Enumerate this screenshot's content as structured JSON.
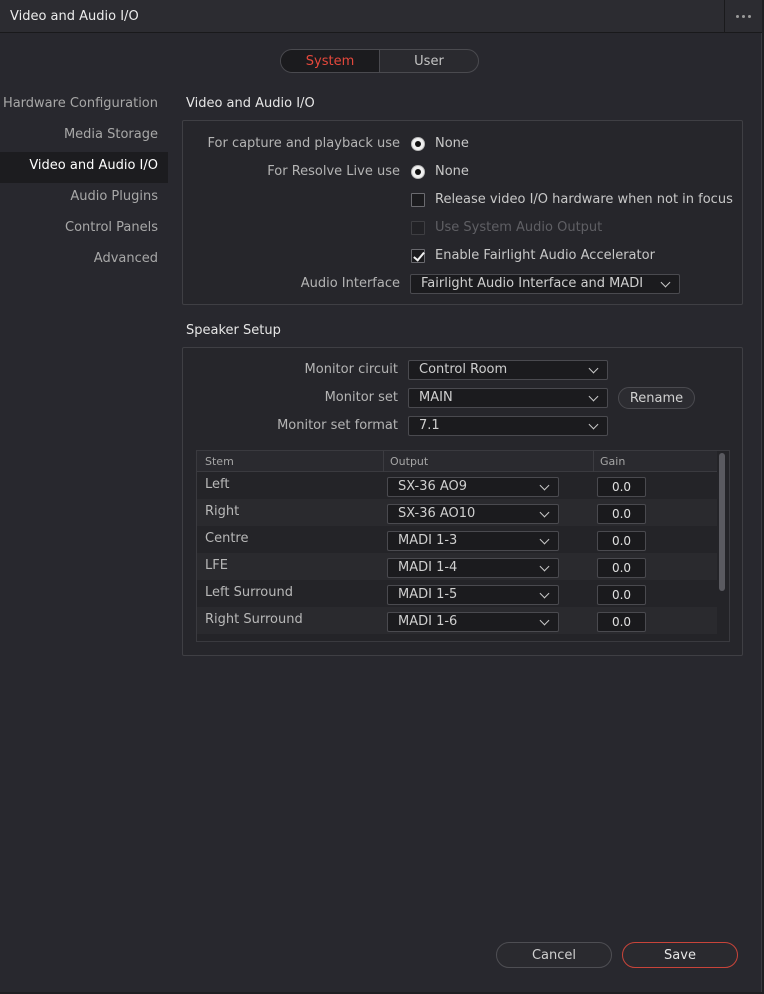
{
  "window": {
    "title": "Video and Audio I/O"
  },
  "tabs": [
    {
      "label": "System"
    },
    {
      "label": "User"
    }
  ],
  "sidebar": {
    "items": [
      {
        "label": "Hardware Configuration"
      },
      {
        "label": "Media Storage"
      },
      {
        "label": "Video and Audio I/O"
      },
      {
        "label": "Audio Plugins"
      },
      {
        "label": "Control Panels"
      },
      {
        "label": "Advanced"
      }
    ],
    "active": "Video and Audio I/O"
  },
  "io": {
    "title": "Video and Audio I/O",
    "capture_label": "For capture and playback use",
    "capture_value": "None",
    "live_label": "For Resolve Live use",
    "live_value": "None",
    "release_label": "Release video I/O hardware when not in focus",
    "release_checked": false,
    "system_audio_label": "Use System Audio Output",
    "system_audio_disabled": true,
    "fairlight_label": "Enable Fairlight Audio Accelerator",
    "fairlight_checked": true,
    "audio_interface_label": "Audio Interface",
    "audio_interface_value": "Fairlight Audio Interface and MADI"
  },
  "speaker": {
    "title": "Speaker Setup",
    "monitor_circuit_label": "Monitor circuit",
    "monitor_circuit_value": "Control Room",
    "monitor_set_label": "Monitor set",
    "monitor_set_value": "MAIN",
    "rename_label": "Rename",
    "monitor_format_label": "Monitor set format",
    "monitor_format_value": "7.1",
    "table": {
      "headers": {
        "stem": "Stem",
        "output": "Output",
        "gain": "Gain"
      },
      "rows": [
        {
          "stem": "Left",
          "output": "SX-36 AO9",
          "gain": "0.0"
        },
        {
          "stem": "Right",
          "output": "SX-36 AO10",
          "gain": "0.0"
        },
        {
          "stem": "Centre",
          "output": "MADI 1-3",
          "gain": "0.0"
        },
        {
          "stem": "LFE",
          "output": "MADI 1-4",
          "gain": "0.0"
        },
        {
          "stem": "Left Surround",
          "output": "MADI 1-5",
          "gain": "0.0"
        },
        {
          "stem": "Right Surround",
          "output": "MADI 1-6",
          "gain": "0.0"
        }
      ]
    }
  },
  "footer": {
    "cancel_label": "Cancel",
    "save_label": "Save"
  },
  "colors": {
    "accent": "#e4483c",
    "save_border": "#c8443a",
    "background": "#28282e"
  },
  "icons": {
    "more": "more-horizontal-icon",
    "dropdown": "chevron-down-icon",
    "check": "checkmark-icon"
  }
}
